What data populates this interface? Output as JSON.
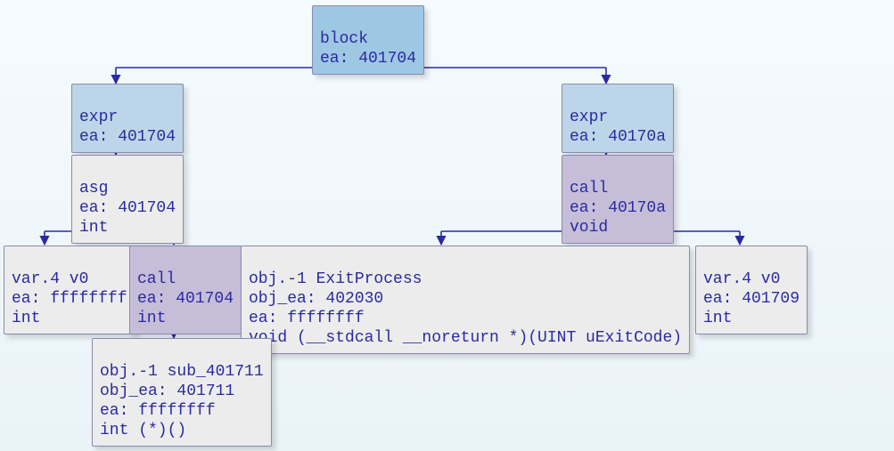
{
  "nodes": {
    "block": {
      "line1": "block",
      "line2": "ea: 401704"
    },
    "expr_l": {
      "line1": "expr",
      "line2": "ea: 401704"
    },
    "expr_r": {
      "line1": "expr",
      "line2": "ea: 40170a"
    },
    "asg": {
      "line1": "asg",
      "line2": "ea: 401704",
      "line3": "int"
    },
    "call_r": {
      "line1": "call",
      "line2": "ea: 40170a",
      "line3": "void"
    },
    "var_l": {
      "line1": "var.4 v0",
      "line2": "ea: ffffffff",
      "line3": "int"
    },
    "call_l": {
      "line1": "call",
      "line2": "ea: 401704",
      "line3": "int"
    },
    "obj_exit": {
      "line1": "obj.-1 ExitProcess",
      "line2": "obj_ea: 402030",
      "line3": "ea: ffffffff",
      "line4": "void (__stdcall __noreturn *)(UINT uExitCode)"
    },
    "var_r": {
      "line1": "var.4 v0",
      "line2": "ea: 401709",
      "line3": "int"
    },
    "obj_sub": {
      "line1": "obj.-1 sub_401711",
      "line2": "obj_ea: 401711",
      "line3": "ea: ffffffff",
      "line4": "int (*)()"
    }
  }
}
